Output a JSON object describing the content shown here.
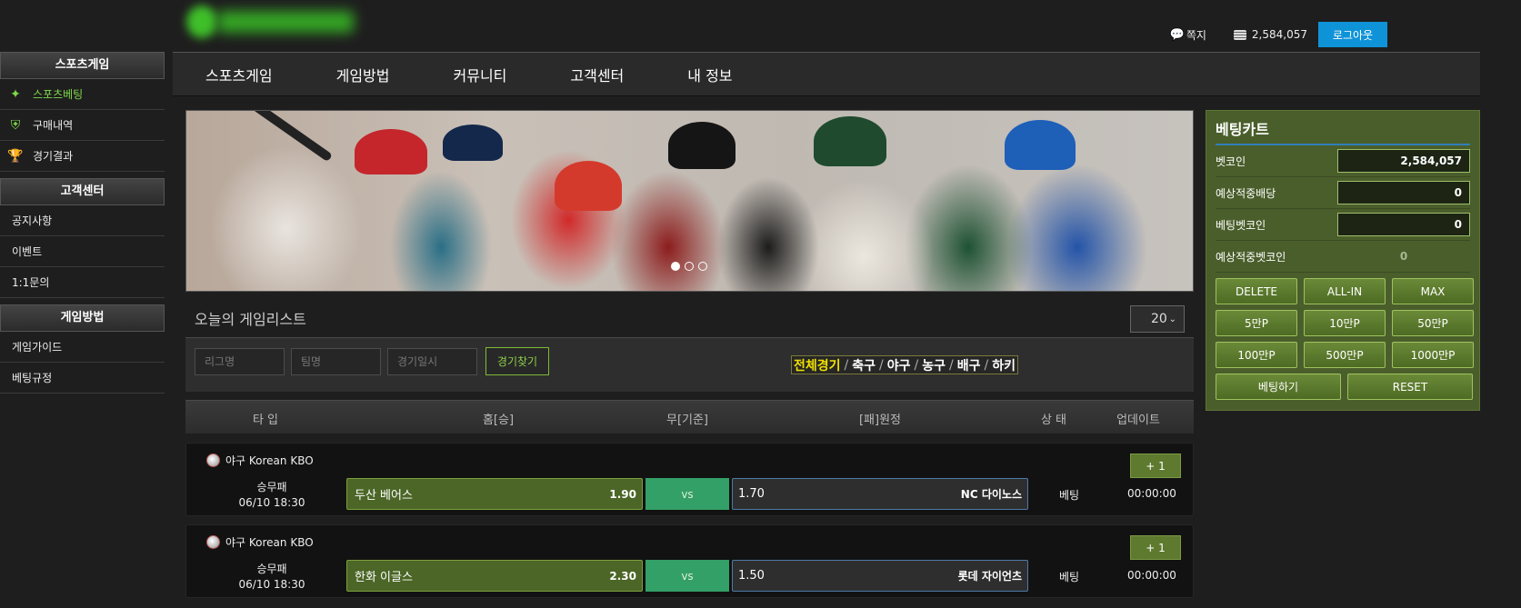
{
  "topbar": {
    "message_label": "쪽지",
    "balance": "2,584,057",
    "logout_label": "로그아웃"
  },
  "sidebar": {
    "sections": [
      {
        "title": "스포츠게임",
        "items": [
          "스포츠베팅",
          "구매내역",
          "경기결과"
        ]
      },
      {
        "title": "고객센터",
        "items": [
          "공지사항",
          "이벤트",
          "1:1문의"
        ]
      },
      {
        "title": "게임방법",
        "items": [
          "게임가이드",
          "베팅규정"
        ]
      }
    ],
    "icons": [
      "bet-icon",
      "cart-icon",
      "trophy-icon"
    ]
  },
  "nav": {
    "items": [
      "스포츠게임",
      "게임방법",
      "커뮤니티",
      "고객센터",
      "내 정보"
    ]
  },
  "banner": {
    "slides": 3,
    "active_slide": 1
  },
  "list": {
    "title": "오늘의 게임리스트",
    "page_size": "20",
    "filters": {
      "league_placeholder": "리그명",
      "team_placeholder": "팀명",
      "date_placeholder": "경기일시",
      "search_label": "경기찾기"
    },
    "categories": [
      "전체경기",
      "축구",
      "야구",
      "농구",
      "배구",
      "하키"
    ],
    "active_category": "전체경기",
    "columns": [
      "타 입",
      "홈[승]",
      "무[기준]",
      "[패]원정",
      "상 태",
      "업데이트"
    ]
  },
  "matches": [
    {
      "league": "야구 Korean KBO",
      "type": "승무패",
      "datetime": "06/10 18:30",
      "home": "두산 베어스",
      "home_odds": "1.90",
      "draw": "vs",
      "away_odds": "1.70",
      "away": "NC 다이노스",
      "status": "베팅",
      "update": "00:00:00",
      "more": "+ 1"
    },
    {
      "league": "야구 Korean KBO",
      "type": "승무패",
      "datetime": "06/10 18:30",
      "home": "한화 이글스",
      "home_odds": "2.30",
      "draw": "vs",
      "away_odds": "1.50",
      "away": "롯데 자이언츠",
      "status": "베팅",
      "update": "00:00:00",
      "more": "+ 1"
    }
  ],
  "cart": {
    "title": "베팅카트",
    "rows": [
      {
        "label": "벳코인",
        "value": "2,584,057"
      },
      {
        "label": "예상적중배당",
        "value": "0"
      },
      {
        "label": "베팅벳코인",
        "value": "0"
      },
      {
        "label": "예상적중벳코인",
        "value": "0"
      }
    ],
    "buttons": [
      "DELETE",
      "ALL-IN",
      "MAX",
      "5만P",
      "10만P",
      "50만P",
      "100만P",
      "500만P",
      "1000만P"
    ],
    "bet_label": "베팅하기",
    "reset_label": "RESET"
  },
  "colors": {
    "accent_green": "#7ed84a",
    "cart_bg": "#4a5e2b",
    "logout_blue": "#0f93d8",
    "vs_green": "#33a067",
    "category_active": "#f0e000"
  }
}
